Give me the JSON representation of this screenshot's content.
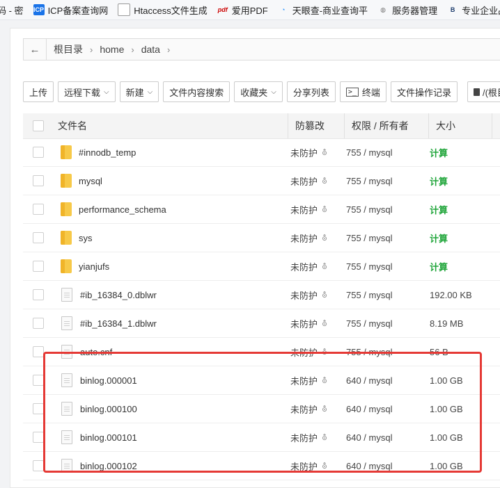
{
  "bookmarks": [
    {
      "label": "码 - 密",
      "icon": "none"
    },
    {
      "label": "ICP备案查询网",
      "icon": "icp-icon"
    },
    {
      "label": "Htaccess文件生成",
      "icon": "page-icon"
    },
    {
      "label": "爱用PDF",
      "icon": "pdf-icon"
    },
    {
      "label": "天眼查-商业查询平",
      "icon": "tianyancha-icon"
    },
    {
      "label": "服务器管理",
      "icon": "globe-icon"
    },
    {
      "label": "专业企业品牌推广",
      "icon": "b-logo-icon"
    }
  ],
  "path": {
    "back": "←",
    "crumbs": [
      "根目录",
      "home",
      "data"
    ]
  },
  "toolbar": {
    "upload": "上传",
    "remote_download": "远程下载",
    "new": "新建",
    "search_content": "文件内容搜索",
    "favorites": "收藏夹",
    "share_list": "分享列表",
    "terminal": "终端",
    "operation_log": "文件操作记录",
    "root_label": "/(根目录)"
  },
  "table": {
    "headers": {
      "name": "文件名",
      "tamper": "防篡改",
      "perm": "权限 / 所有者",
      "size": "大小"
    },
    "rows": [
      {
        "type": "folder",
        "name": "#innodb_temp",
        "tamper": "未防护",
        "perm": "755 / mysql",
        "size": "计算"
      },
      {
        "type": "folder",
        "name": "mysql",
        "tamper": "未防护",
        "perm": "755 / mysql",
        "size": "计算"
      },
      {
        "type": "folder",
        "name": "performance_schema",
        "tamper": "未防护",
        "perm": "755 / mysql",
        "size": "计算"
      },
      {
        "type": "folder",
        "name": "sys",
        "tamper": "未防护",
        "perm": "755 / mysql",
        "size": "计算"
      },
      {
        "type": "folder",
        "name": "yianjufs",
        "tamper": "未防护",
        "perm": "755 / mysql",
        "size": "计算"
      },
      {
        "type": "file",
        "name": "#ib_16384_0.dblwr",
        "tamper": "未防护",
        "perm": "755 / mysql",
        "size": "192.00 KB"
      },
      {
        "type": "file",
        "name": "#ib_16384_1.dblwr",
        "tamper": "未防护",
        "perm": "755 / mysql",
        "size": "8.19 MB"
      },
      {
        "type": "file",
        "name": "auto.cnf",
        "tamper": "未防护",
        "perm": "755 / mysql",
        "size": "56 B"
      },
      {
        "type": "file",
        "name": "binlog.000001",
        "tamper": "未防护",
        "perm": "640 / mysql",
        "size": "1.00 GB"
      },
      {
        "type": "file",
        "name": "binlog.000100",
        "tamper": "未防护",
        "perm": "640 / mysql",
        "size": "1.00 GB"
      },
      {
        "type": "file",
        "name": "binlog.000101",
        "tamper": "未防护",
        "perm": "640 / mysql",
        "size": "1.00 GB"
      },
      {
        "type": "file",
        "name": "binlog.000102",
        "tamper": "未防护",
        "perm": "640 / mysql",
        "size": "1.00 GB"
      }
    ]
  },
  "colors": {
    "highlight": "#e53935",
    "calc_green": "#20a53a"
  }
}
